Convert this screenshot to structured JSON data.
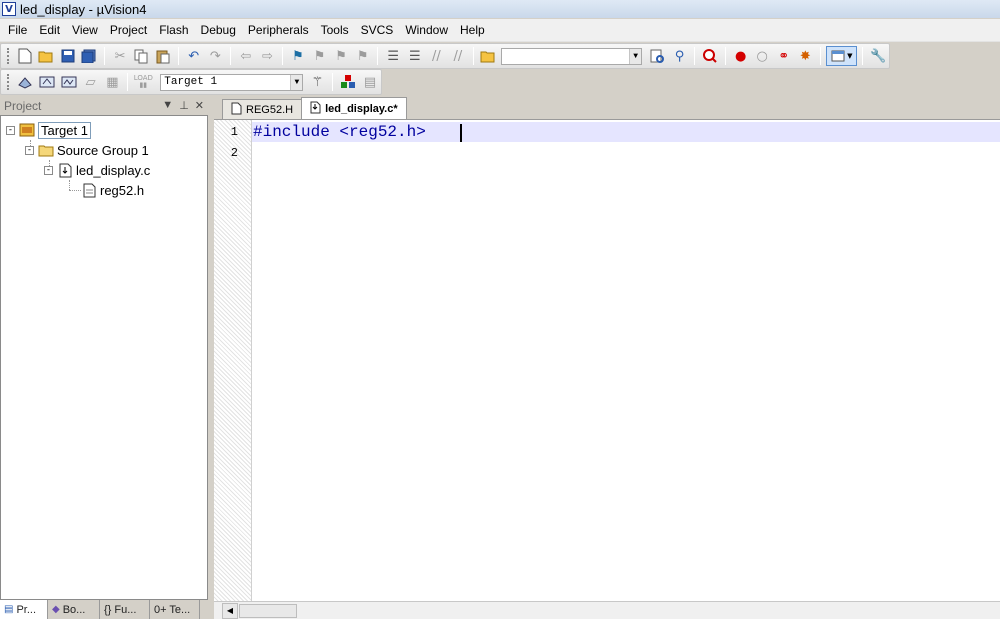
{
  "window": {
    "title": "led_display  - µVision4",
    "icon_letter": "V"
  },
  "menu": [
    "File",
    "Edit",
    "View",
    "Project",
    "Flash",
    "Debug",
    "Peripherals",
    "Tools",
    "SVCS",
    "Window",
    "Help"
  ],
  "toolbar2": {
    "target_select": "Target 1",
    "load_label": "LOAD"
  },
  "project_panel": {
    "title": "Project",
    "tree": [
      {
        "label": "Target 1",
        "depth": 0,
        "icon": "target-icon",
        "expander": "-",
        "selected": true
      },
      {
        "label": "Source Group 1",
        "depth": 1,
        "icon": "folder-icon",
        "expander": "-"
      },
      {
        "label": "led_display.c",
        "depth": 2,
        "icon": "c-file-icon",
        "expander": "-"
      },
      {
        "label": "reg52.h",
        "depth": 3,
        "icon": "header-file-icon"
      }
    ],
    "bottom_tabs": [
      "Pr...",
      "Bo...",
      "{} Fu...",
      "0+ Te..."
    ]
  },
  "editor": {
    "tabs": [
      {
        "label": "REG52.H",
        "active": false
      },
      {
        "label": "led_display.c*",
        "active": true
      }
    ],
    "lines": [
      {
        "num": "1",
        "text": "#include <reg52.h>"
      },
      {
        "num": "2",
        "text": ""
      }
    ]
  },
  "colors": {
    "code_text": "#00009e",
    "current_line": "#e5e5ff",
    "accent": "#1f3f99"
  }
}
